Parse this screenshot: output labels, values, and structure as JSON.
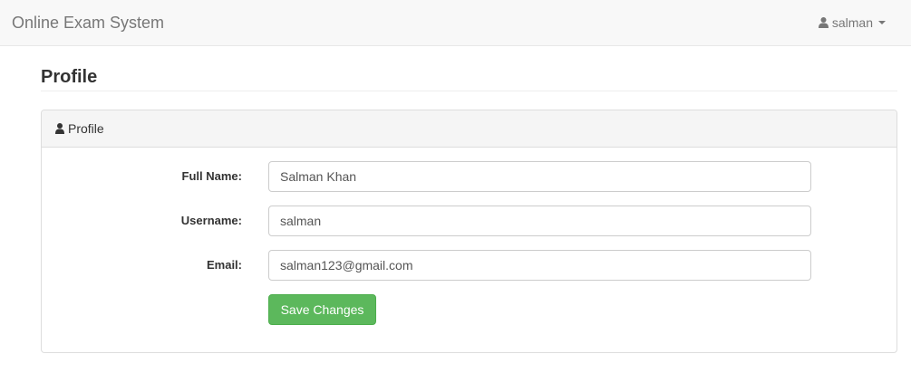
{
  "navbar": {
    "brand": "Online Exam System",
    "user": {
      "icon": "user-icon",
      "name": "salman",
      "menu_icon": "caret-down-icon"
    }
  },
  "page": {
    "title": "Profile"
  },
  "panel": {
    "heading": {
      "icon": "user-icon",
      "label": "Profile"
    },
    "fields": [
      {
        "label": "Full Name:",
        "value": "Salman Khan"
      },
      {
        "label": "Username:",
        "value": "salman"
      },
      {
        "label": "Email:",
        "value": "salman123@gmail.com"
      }
    ],
    "save_label": "Save Changes"
  },
  "colors": {
    "accent_green": "#5cb85c",
    "navbar_bg": "#f8f8f8"
  }
}
